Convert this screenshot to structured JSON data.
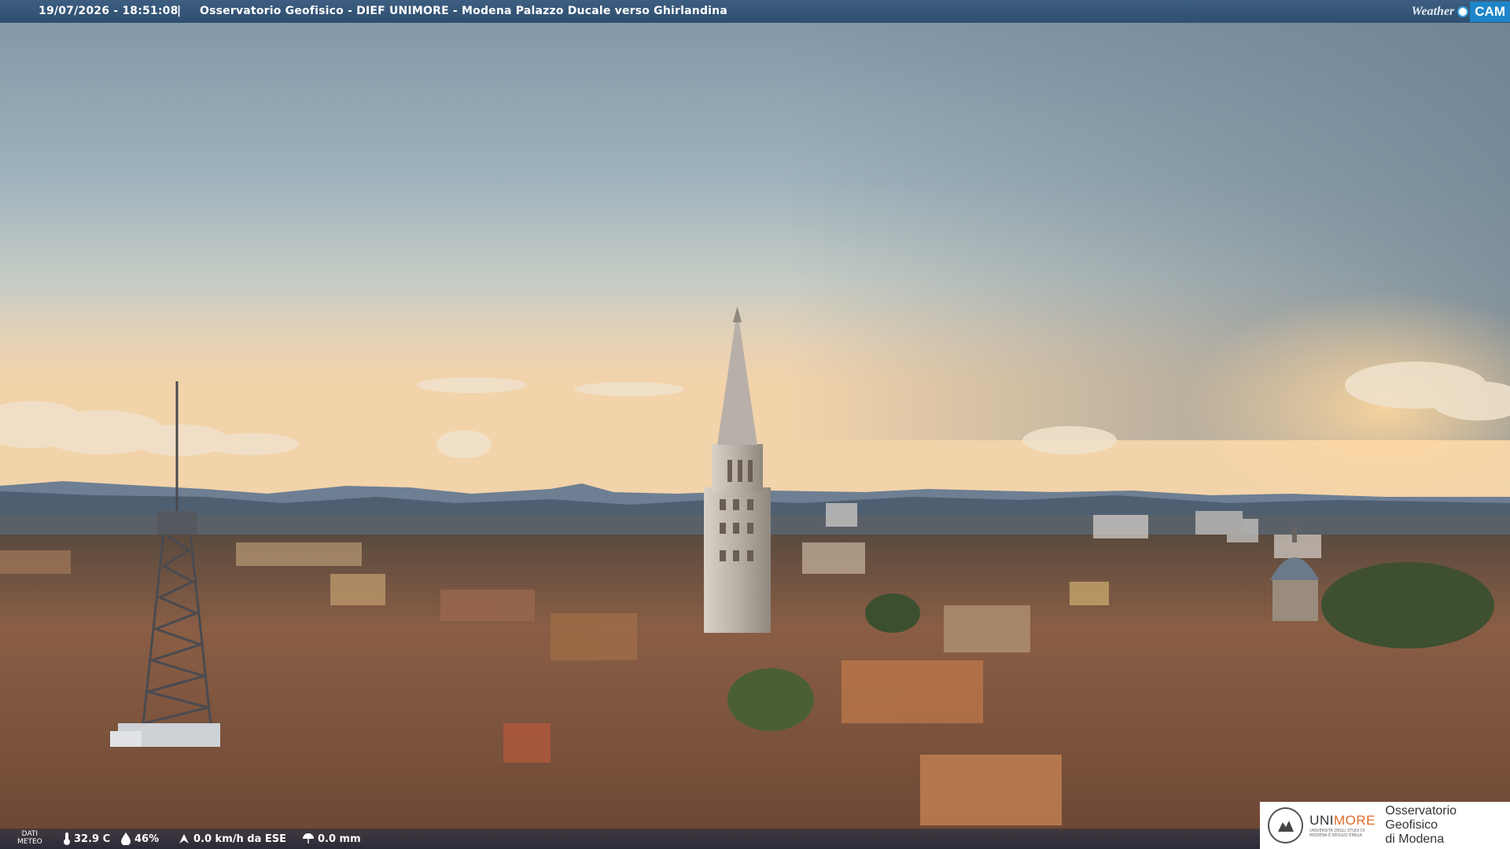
{
  "header": {
    "timestamp": "19/07/2026 - 18:51:08",
    "separator": "|",
    "title": "Osservatorio Geofisico - DIEF UNIMORE - Modena Palazzo Ducale verso Ghirlandina"
  },
  "logo": {
    "weather": "Weather",
    "cam": "CAM"
  },
  "footer": {
    "dati_meteo_line1": "DATI",
    "dati_meteo_line2": "METEO",
    "temperature": "32.9 C",
    "humidity": "46%",
    "wind": "0.0 km/h da ESE",
    "rain": "0.0 mm"
  },
  "branding": {
    "uni_prefix": "UNI",
    "uni_suffix": "MORE",
    "uni_sub1": "UNIVERSITÀ DEGLI STUDI DI",
    "uni_sub2": "MODENA E REGGIO EMILIA",
    "observatory_line1": "Osservatorio Geofisico",
    "observatory_line2": "di Modena"
  },
  "colors": {
    "bar": "#34547a",
    "accent": "#e06a2a",
    "cam_blue": "#1e86c8"
  }
}
